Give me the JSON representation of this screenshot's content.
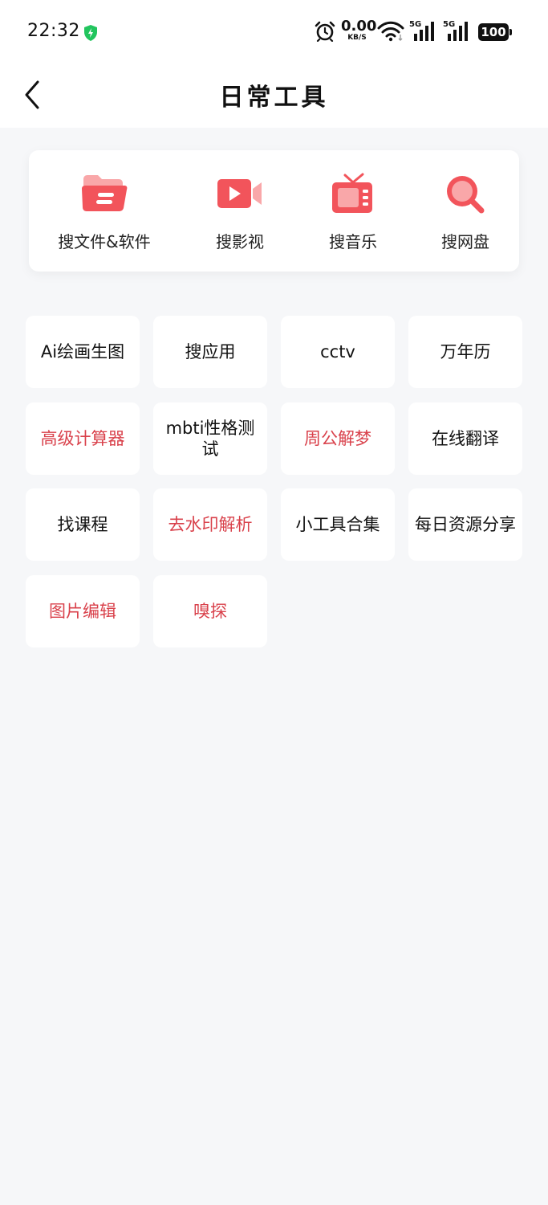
{
  "status_bar": {
    "time": "22:32",
    "net_speed_value": "0.00",
    "net_speed_unit": "KB/S",
    "signal1_label": "5G",
    "signal2_label": "5G",
    "battery": "100"
  },
  "header": {
    "title": "日常工具"
  },
  "quick_actions": [
    {
      "label": "搜文件&软件",
      "icon": "folder-icon"
    },
    {
      "label": "搜影视",
      "icon": "video-camera-icon"
    },
    {
      "label": "搜音乐",
      "icon": "radio-icon"
    },
    {
      "label": "搜网盘",
      "icon": "magnifier-icon"
    }
  ],
  "tools": [
    {
      "label": "Ai绘画生图",
      "highlight": false
    },
    {
      "label": "搜应用",
      "highlight": false
    },
    {
      "label": "cctv",
      "highlight": false
    },
    {
      "label": "万年历",
      "highlight": false
    },
    {
      "label": "高级计算器",
      "highlight": true
    },
    {
      "label": "mbti性格测试",
      "highlight": false
    },
    {
      "label": "周公解梦",
      "highlight": true
    },
    {
      "label": "在线翻译",
      "highlight": false
    },
    {
      "label": "找课程",
      "highlight": false
    },
    {
      "label": "去水印解析",
      "highlight": true
    },
    {
      "label": "小工具合集",
      "highlight": false
    },
    {
      "label": "每日资源分享",
      "highlight": false
    },
    {
      "label": "图片编辑",
      "highlight": true
    },
    {
      "label": "嗅探",
      "highlight": true
    }
  ],
  "colors": {
    "accent": "#f2545b",
    "highlight_text": "#d9414b",
    "background": "#f6f7f9"
  }
}
